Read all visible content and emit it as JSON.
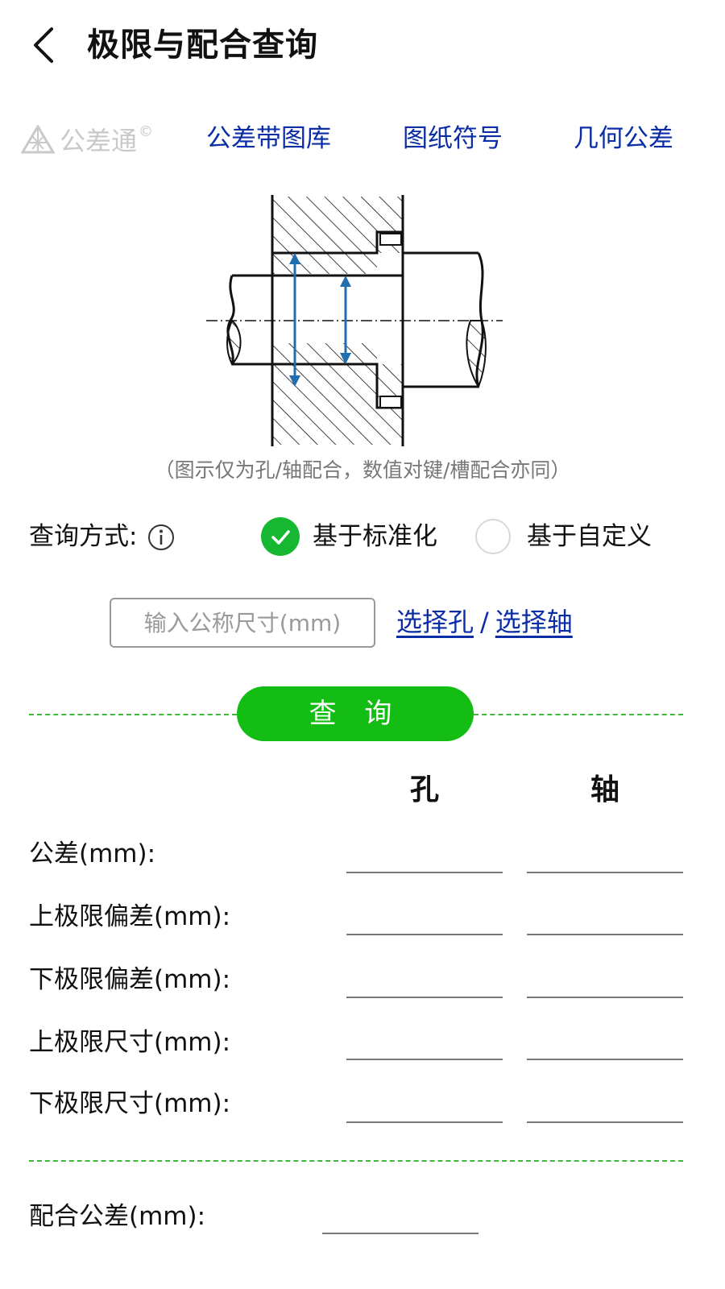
{
  "header": {
    "title": "极限与配合查询",
    "back_icon": "chevron-left-icon"
  },
  "nav": {
    "brand": {
      "name": "公差通",
      "mark": "©",
      "icon": "pyramid-logo-icon",
      "color": "#c9c9c9"
    },
    "links": [
      "公差带图库",
      "图纸符号",
      "几何公差"
    ],
    "link_color": "#0b2da6"
  },
  "diagram": {
    "caption": "（图示仅为孔/轴配合，数值对键/槽配合亦同）",
    "arrow_color": "#1f6fb0"
  },
  "query_mode": {
    "label": "查询方式:",
    "info_icon": "info-circle-icon",
    "options": [
      {
        "label": "基于标准化",
        "selected": true
      },
      {
        "label": "基于自定义",
        "selected": false
      }
    ],
    "accent": "#16b832"
  },
  "size_input": {
    "placeholder": "输入公称尺寸(mm)",
    "value": ""
  },
  "select": {
    "hole": "选择孔",
    "separator": "/",
    "shaft": "选择轴"
  },
  "query_button": {
    "label": "查 询",
    "color": "#14bd14"
  },
  "results": {
    "columns": [
      "孔",
      "轴"
    ],
    "rows": [
      {
        "label": "公差(mm):",
        "hole": "",
        "shaft": ""
      },
      {
        "label": "上极限偏差(mm):",
        "hole": "",
        "shaft": ""
      },
      {
        "label": "下极限偏差(mm):",
        "hole": "",
        "shaft": ""
      },
      {
        "label": "上极限尺寸(mm):",
        "hole": "",
        "shaft": ""
      },
      {
        "label": "下极限尺寸(mm):",
        "hole": "",
        "shaft": ""
      }
    ]
  },
  "fit_tolerance": {
    "label": "配合公差(mm):",
    "value": ""
  }
}
